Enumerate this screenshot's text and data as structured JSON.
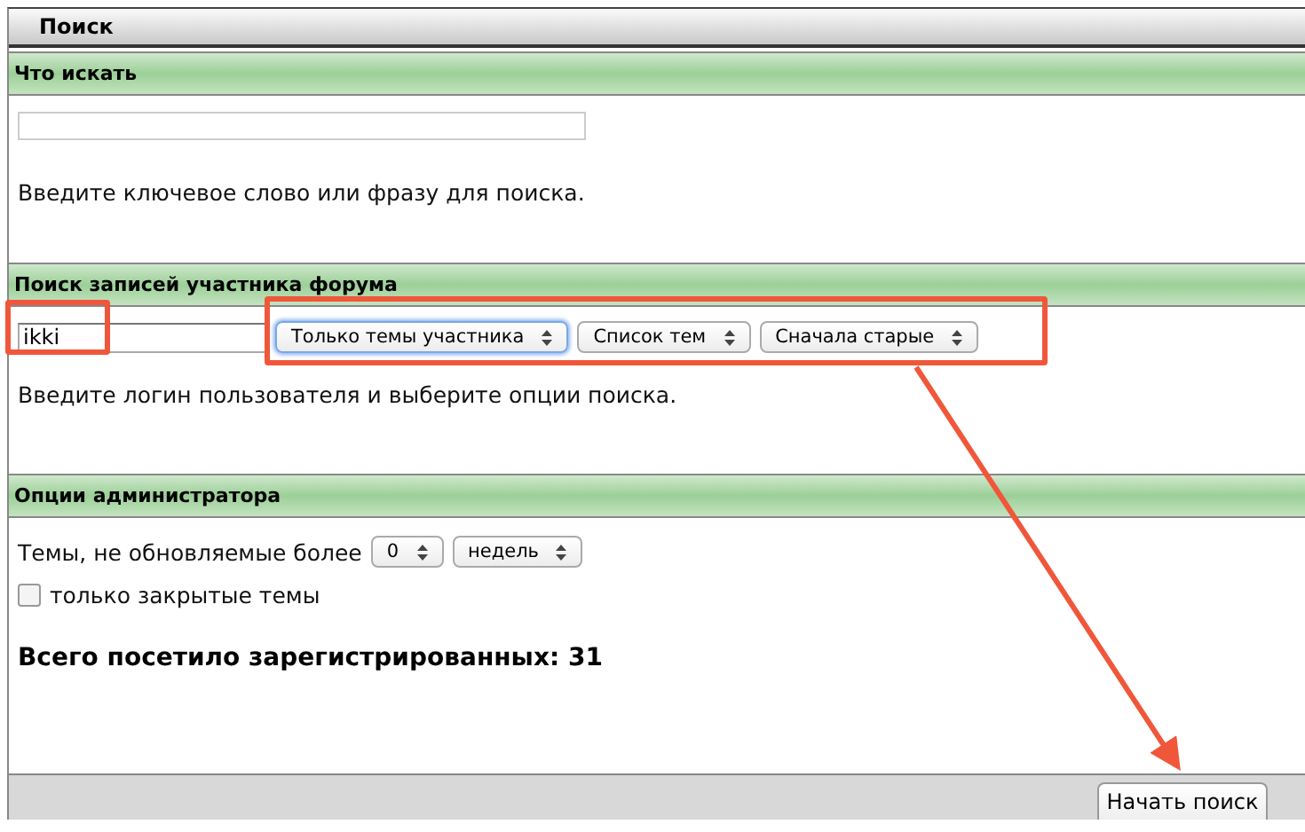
{
  "window": {
    "title": "Поиск"
  },
  "keyword_section": {
    "title": "Что искать",
    "hint": "Введите ключевое слово или фразу для поиска."
  },
  "member_section": {
    "title": "Поиск записей участника форума",
    "username": "ikki",
    "selects": [
      {
        "value": "Только темы участника",
        "focused": true
      },
      {
        "value": "Список тем",
        "focused": false
      },
      {
        "value": "Сначала старые",
        "focused": false
      }
    ],
    "hint": "Введите логин пользователя и выберите опции поиска."
  },
  "admin_section": {
    "title": "Опции администратора",
    "age_label": "Темы, не обновляемые более",
    "age_selects": [
      {
        "value": "0",
        "focused": false
      },
      {
        "value": "недель",
        "focused": false
      }
    ],
    "closed_only": {
      "label": "только закрытые темы",
      "checked": false
    }
  },
  "visited": "Всего посетило зарегистрированных: 31",
  "footer": {
    "submit": "Начать поиск"
  }
}
